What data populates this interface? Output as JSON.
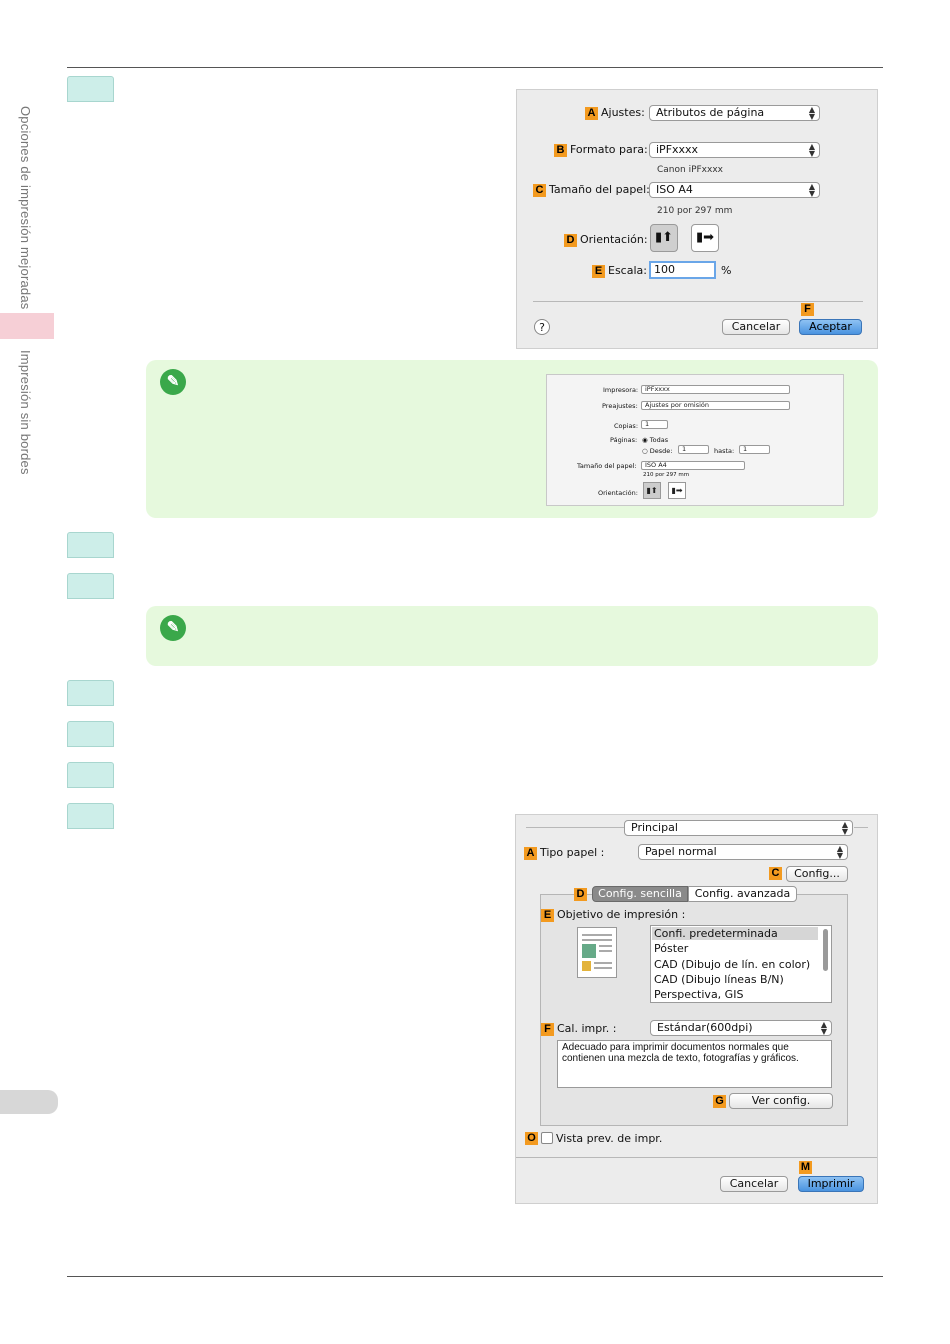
{
  "sidebar": {
    "text_top": "Opciones de impresión mejoradas",
    "text_bottom": "Impresión sin bordes"
  },
  "dialog1": {
    "ajustes_label": "Ajustes:",
    "ajustes_value": "Atributos de página",
    "formato_label": "Formato para:",
    "formato_value": "iPFxxxx",
    "formato_sub": "Canon iPFxxxx",
    "tamano_label": "Tamaño del papel:",
    "tamano_value": "ISO A4",
    "tamano_sub": "210 por 297 mm",
    "orientacion_label": "Orientación:",
    "escala_label": "Escala:",
    "escala_value": "100",
    "escala_unit": "%",
    "help": "?",
    "cancel": "Cancelar",
    "ok": "Aceptar",
    "badges": {
      "a": "A",
      "b": "B",
      "c": "C",
      "d": "D",
      "e": "E",
      "f": "F"
    }
  },
  "mini_dialog": {
    "impresora_label": "Impresora:",
    "impresora_value": "iPFxxxx",
    "preajustes_label": "Preajustes:",
    "preajustes_value": "Ajustes por omisión",
    "copias_label": "Copias:",
    "copias_value": "1",
    "paginas_label": "Páginas:",
    "todas": "Todas",
    "desde": "Desde:",
    "desde_value": "1",
    "hasta": "hasta:",
    "hasta_value": "1",
    "tamano_label": "Tamaño del papel:",
    "tamano_value": "ISO A4",
    "tamano_sub": "210 por 297 mm",
    "orientacion_label": "Orientación:"
  },
  "dialog2": {
    "principal": "Principal",
    "tipo_papel_label": "Tipo papel :",
    "tipo_papel_value": "Papel normal",
    "config_btn": "Config...",
    "tab_sencilla": "Config. sencilla",
    "tab_avanzada": "Config. avanzada",
    "objetivo_label": "Objetivo de impresión :",
    "objetivo_items": [
      "Confi. predeterminada",
      "Póster",
      "CAD (Dibujo de lín. en color)",
      "CAD (Dibujo líneas B/N)",
      "Perspectiva, GIS"
    ],
    "cal_label": "Cal. impr. :",
    "cal_value": "Estándar(600dpi)",
    "description": "Adecuado para imprimir documentos normales que contienen una mezcla de texto, fotografías y gráficos.",
    "ver_config": "Ver config.",
    "vista_prev": "Vista prev. de impr.",
    "cancel": "Cancelar",
    "print": "Imprimir",
    "badges": {
      "a": "A",
      "c": "C",
      "d": "D",
      "e": "E",
      "f": "F",
      "g": "G",
      "o": "O",
      "m": "M"
    }
  },
  "icons": {
    "note": "pencil-note-icon",
    "select": "up-down-arrows-icon"
  },
  "colors": {
    "badge": "#f39a1f",
    "step_tab": "#cdeee9",
    "note_bg": "#e6f9dd",
    "note_icon": "#3aa84a",
    "default_button": "#4a93e0"
  }
}
